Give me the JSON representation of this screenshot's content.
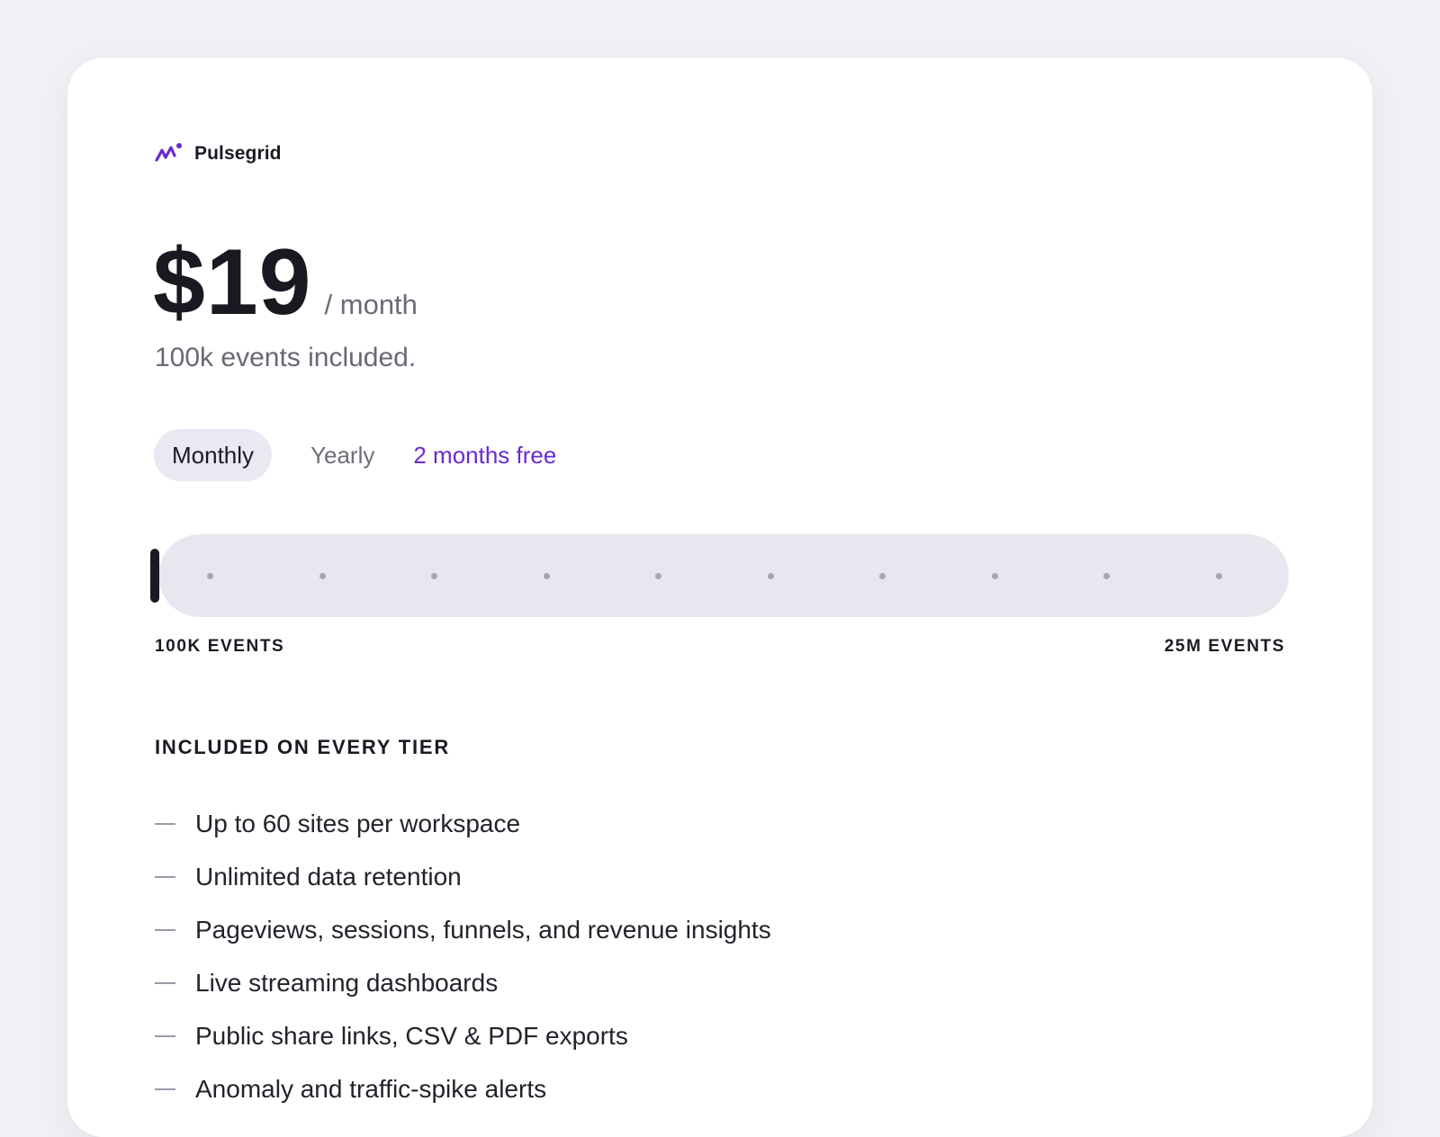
{
  "brand": {
    "name": "Pulsegrid",
    "logo_icon": "pulse-icon",
    "accent": "#6a2bd1"
  },
  "pricing": {
    "price": "$19",
    "period": "/ month",
    "events_included": "100k events included."
  },
  "billing": {
    "options": [
      "Monthly",
      "Yearly"
    ],
    "selected": "Monthly",
    "promo": "2 months free"
  },
  "volume_slider": {
    "min_label": "100K EVENTS",
    "max_label": "25M EVENTS",
    "value_fraction": 0,
    "tick_count": 10
  },
  "features": {
    "heading": "INCLUDED ON EVERY TIER",
    "items": [
      "Up to 60 sites per workspace",
      "Unlimited data retention",
      "Pageviews, sessions, funnels, and revenue insights",
      "Live streaming dashboards",
      "Public share links, CSV & PDF exports",
      "Anomaly and traffic-spike alerts"
    ]
  }
}
